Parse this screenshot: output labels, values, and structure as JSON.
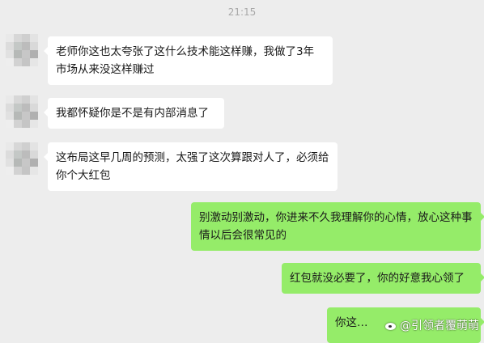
{
  "timestamp": "21:15",
  "messages": [
    {
      "side": "in",
      "text": "老师你这也太夸张了这什么技术能这样赚，我做了3年市场从来没这样赚过"
    },
    {
      "side": "in",
      "text": "我都怀疑你是不是有内部消息了"
    },
    {
      "side": "in",
      "text": "这布局这早几周的预测，太强了这次算跟对人了，必须给你个大红包"
    },
    {
      "side": "out",
      "text": "别激动别激动，你进来不久我理解你的心情，放心这种事情以后会很常见的"
    },
    {
      "side": "out",
      "text": "红包就没必要了，你的好意我心领了"
    },
    {
      "side": "out",
      "text": "你这…"
    }
  ],
  "watermark": {
    "icon": "weibo-icon",
    "text": "@引领者覆萌萌"
  },
  "colors": {
    "background": "#ededed",
    "incoming_bubble": "#ffffff",
    "outgoing_bubble": "#95ec69",
    "timestamp": "#a8a8a8"
  }
}
